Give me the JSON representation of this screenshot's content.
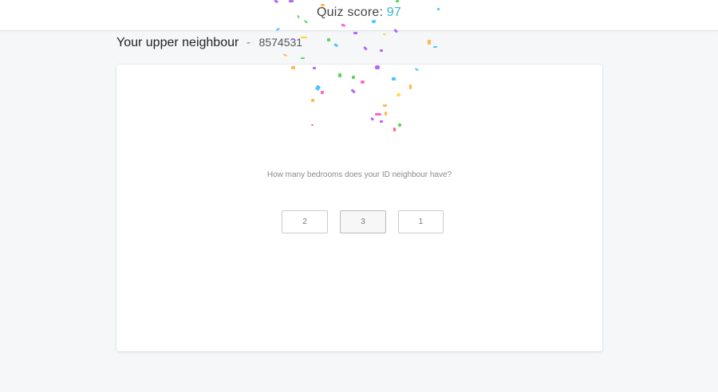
{
  "header": {
    "score_label": "Quiz score:",
    "score_value": "97"
  },
  "page": {
    "title": "Your upper neighbour",
    "separator": "-",
    "neighbour_id": "8574531"
  },
  "quiz": {
    "question": "How many bedrooms does your ID neighbour have?",
    "answers": [
      {
        "label": "2",
        "selected": false
      },
      {
        "label": "3",
        "selected": true
      },
      {
        "label": "1",
        "selected": false
      }
    ]
  },
  "colors": {
    "score_accent": "#3ab5c9",
    "confetti": [
      "#b266ff",
      "#ff66cc",
      "#ffb84d",
      "#5cd65c",
      "#4dc3ff",
      "#ff6680",
      "#ffd633"
    ]
  }
}
